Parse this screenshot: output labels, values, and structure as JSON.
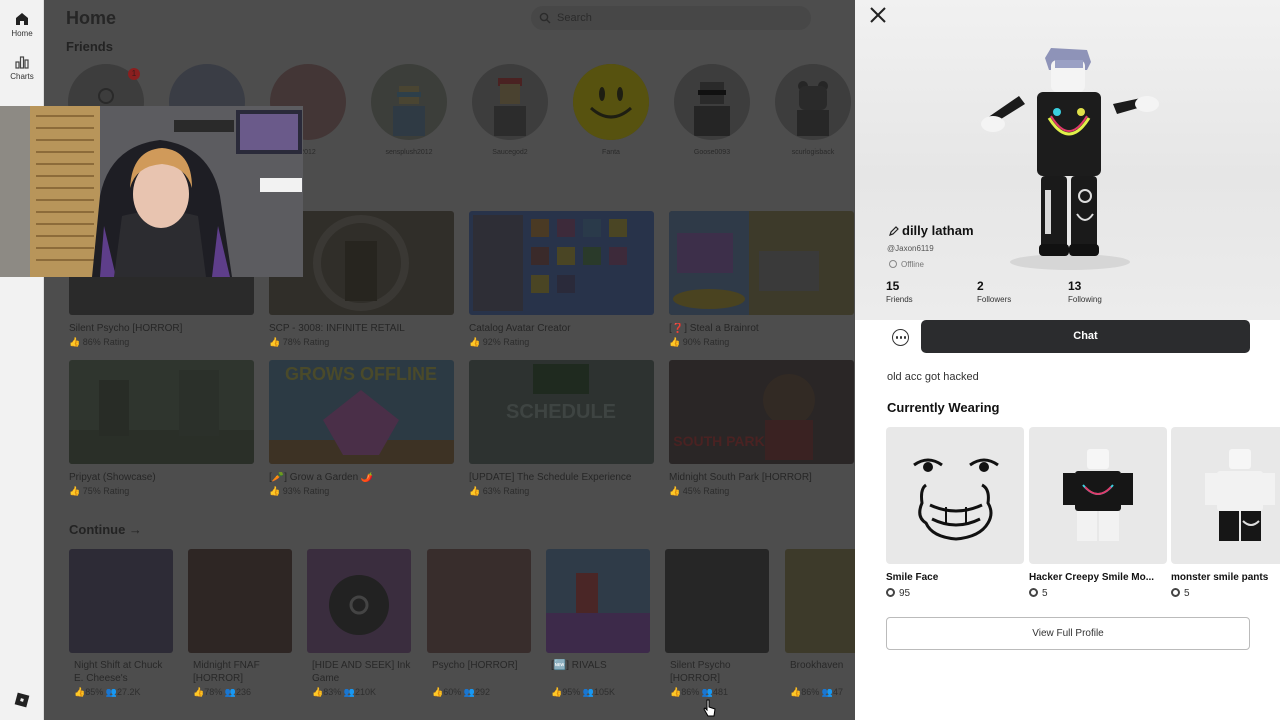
{
  "nav": {
    "items": [
      {
        "label": "Home",
        "icon": "home-icon"
      },
      {
        "label": "Charts",
        "icon": "charts-icon"
      }
    ],
    "logo_icon": "roblox-logo-icon"
  },
  "home": {
    "title": "Home",
    "search_placeholder": "Search",
    "friends_title": "Friends",
    "friend_request_count": "1",
    "friends": [
      {
        "name": ""
      },
      {
        "name": ""
      },
      {
        "name": "2012"
      },
      {
        "name": "sensplush2012"
      },
      {
        "name": "Saucegod2"
      },
      {
        "name": "Fanta"
      },
      {
        "name": "Goose0093"
      },
      {
        "name": "scurlogisback"
      }
    ],
    "games_row1": [
      {
        "name": "Silent Psycho [HORROR]",
        "rating": "86% Rating",
        "color": "#2a2a2a"
      },
      {
        "name": "SCP - 3008: INFINITE RETAIL",
        "rating": "78% Rating",
        "color": "#2f2d28"
      },
      {
        "name": "Catalog Avatar Creator",
        "rating": "92% Rating",
        "color": "#28334a"
      },
      {
        "name": "[❓] Steal a Brainrot",
        "rating": "90% Rating",
        "color": "#3d3a2a"
      }
    ],
    "games_row2": [
      {
        "name": "Pripyat (Showcase)",
        "rating": "75% Rating",
        "color": "#2f352e"
      },
      {
        "name": "[🥕] Grow a Garden 🌶️",
        "rating": "93% Rating",
        "color": "#3b3446"
      },
      {
        "name": "[UPDATE] The Schedule Experience",
        "rating": "63% Rating",
        "color": "#2d3230"
      },
      {
        "name": "Midnight South Park [HORROR]",
        "rating": "45% Rating",
        "color": "#2a2626"
      }
    ],
    "continue_title": "Continue →",
    "continue_games": [
      {
        "name": "Night Shift at Chuck E. Cheese's",
        "rating": "85%",
        "players": "27.2K",
        "color": "#2d2b36"
      },
      {
        "name": "Midnight FNAF [HORROR]",
        "rating": "78%",
        "players": "236",
        "color": "#2e2624"
      },
      {
        "name": "[HIDE AND SEEK] Ink Game",
        "rating": "83%",
        "players": "210K",
        "color": "#3a2d3e"
      },
      {
        "name": "Psycho [HORROR]",
        "rating": "60%",
        "players": "292",
        "color": "#382d2c"
      },
      {
        "name": "[🆕] RIVALS",
        "rating": "95%",
        "players": "105K",
        "color": "#2f3b48"
      },
      {
        "name": "Silent Psycho [HORROR]",
        "rating": "86%",
        "players": "481",
        "color": "#262626"
      },
      {
        "name": "Brookhaven",
        "rating": "86%",
        "players": "47",
        "color": "#3d3a2a"
      }
    ]
  },
  "profile": {
    "display_name": "dilly latham",
    "username": "@Jaxon6119",
    "status": "Offline",
    "stats": [
      {
        "value": "15",
        "label": "Friends"
      },
      {
        "value": "2",
        "label": "Followers"
      },
      {
        "value": "13",
        "label": "Following"
      }
    ],
    "chat_label": "Chat",
    "bio": "old acc got hacked",
    "wearing_title": "Currently Wearing",
    "items": [
      {
        "name": "Smile Face",
        "price": "95"
      },
      {
        "name": "Hacker Creepy Smile Mo...",
        "price": "5"
      },
      {
        "name": "monster smile pants",
        "price": "5"
      }
    ],
    "view_profile_label": "View Full Profile"
  },
  "colors": {
    "chat_button": "#2b2c2e",
    "overlay": "#4d4d4d",
    "panel_bg": "#ffffff"
  }
}
